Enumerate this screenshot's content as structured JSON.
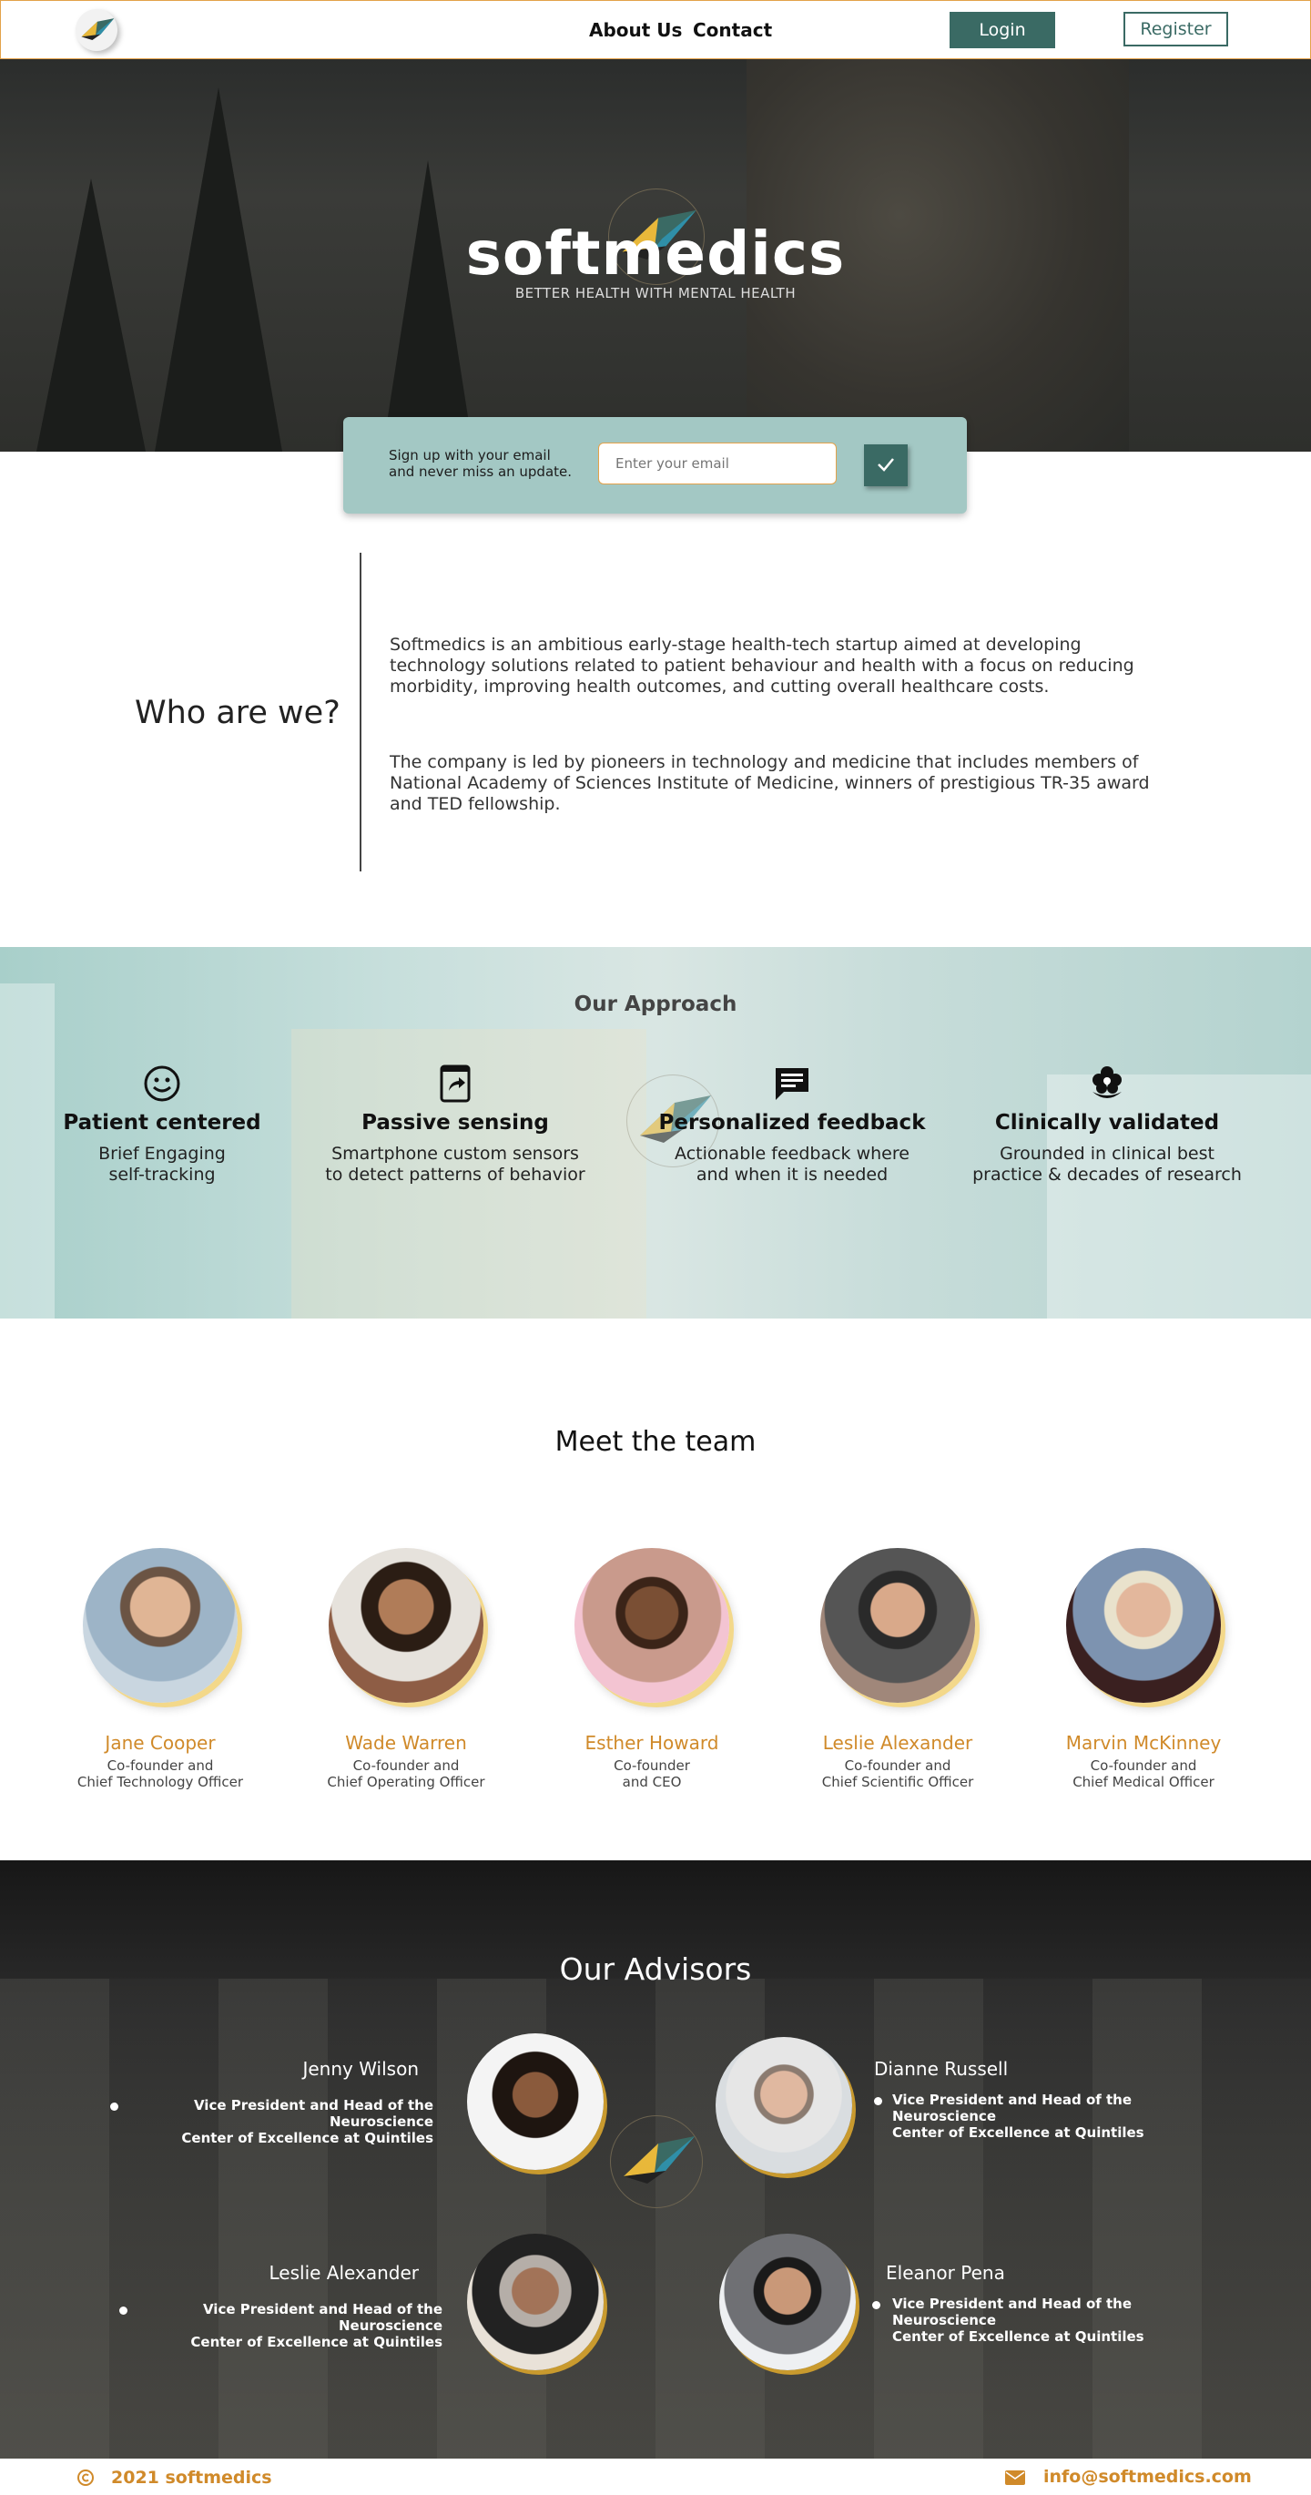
{
  "header": {
    "nav": [
      "About Us",
      "Contact"
    ],
    "login_label": "Login",
    "register_label": "Register"
  },
  "hero": {
    "brand": "softmedics",
    "tagline": "BETTER HEALTH WITH MENTAL HEALTH"
  },
  "signup": {
    "text": "Sign up with your email and never miss an update.",
    "placeholder": "Enter your email",
    "submit_icon": "check-icon"
  },
  "about": {
    "title": "Who are we?",
    "paragraphs": [
      "Softmedics is an ambitious early-stage health-tech startup aimed at developing technology solutions related to patient behaviour and health with a focus on reducing morbidity, improving health outcomes, and cutting overall healthcare costs.",
      "The company is led by pioneers in technology  and medicine that includes members of National Academy of Sciences Institute of Medicine, winners of prestigious TR-35 award and TED fellowship."
    ]
  },
  "approach": {
    "title": "Our Approach",
    "features": [
      {
        "icon": "smiley-icon",
        "title": "Patient centered",
        "desc_1": "Brief Engaging",
        "desc_2": "self-tracking"
      },
      {
        "icon": "share-icon",
        "title": "Passive sensing",
        "desc_1": "Smartphone custom sensors",
        "desc_2": "to detect patterns of behavior"
      },
      {
        "icon": "chat-icon",
        "title": "Personalized feedback",
        "desc_1": "Actionable feedback where",
        "desc_2": "and when it is needed"
      },
      {
        "icon": "flower-icon",
        "title": "Clinically validated",
        "desc_1": "Grounded in clinical best",
        "desc_2": "practice & decades of research"
      }
    ]
  },
  "team": {
    "title": "Meet the team",
    "members": [
      {
        "name": "Jane Cooper",
        "role_1": "Co-founder and",
        "role_2": "Chief Technology Officer"
      },
      {
        "name": "Wade Warren",
        "role_1": "Co-founder and",
        "role_2": "Chief Operating Officer"
      },
      {
        "name": "Esther Howard",
        "role_1": "Co-founder",
        "role_2": "and CEO"
      },
      {
        "name": "Leslie Alexander",
        "role_1": "Co-founder and",
        "role_2": "Chief Scientific Officer"
      },
      {
        "name": "Marvin McKinney",
        "role_1": "Co-founder and",
        "role_2": "Chief Medical Officer"
      }
    ]
  },
  "advisors": {
    "title": "Our Advisors",
    "list": [
      {
        "name": "Jenny Wilson",
        "role_1": "Vice President and Head of the Neuroscience",
        "role_2": "Center of Excellence at Quintiles"
      },
      {
        "name": "Dianne Russell",
        "role_1": "Vice President and Head of the Neuroscience",
        "role_2": "Center of Excellence at Quintiles"
      },
      {
        "name": "Leslie Alexander",
        "role_1": "Vice President and Head of the Neuroscience",
        "role_2": "Center of Excellence at Quintiles"
      },
      {
        "name": "Eleanor Pena",
        "role_1": "Vice President and Head of the Neuroscience",
        "role_2": "Center of Excellence at Quintiles"
      }
    ]
  },
  "footer": {
    "copyright": "2021 softmedics",
    "email": "info@softmedics.com"
  },
  "colors": {
    "accent_orange": "#d08a2a",
    "teal_dark": "#3a6a64",
    "teal_light": "#a3c8c4"
  }
}
